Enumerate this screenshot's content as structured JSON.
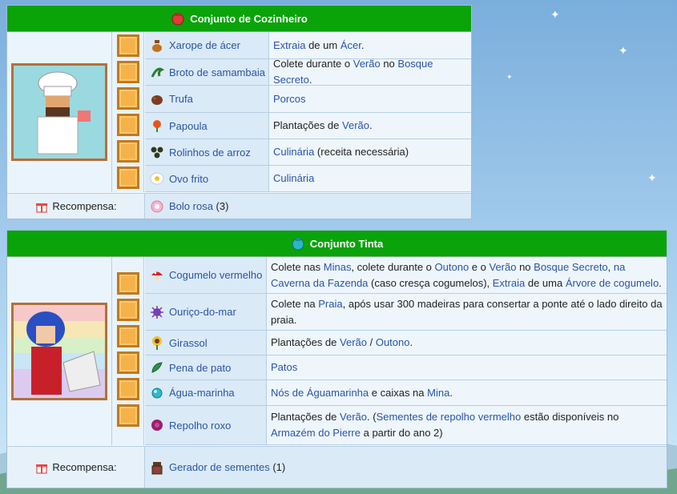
{
  "bundles": [
    {
      "title": "Conjunto de Cozinheiro",
      "items": [
        {
          "name": "Xarope de ácer",
          "desc": [
            {
              "t": "Extraia",
              "link": true
            },
            {
              "t": " de um "
            },
            {
              "t": "Ácer",
              "link": true
            },
            {
              "t": "."
            }
          ]
        },
        {
          "name": "Broto de samambaia",
          "desc": [
            {
              "t": "Colete durante o "
            },
            {
              "t": "Verão",
              "link": true
            },
            {
              "t": " no "
            },
            {
              "t": "Bosque Secreto",
              "link": true
            },
            {
              "t": "."
            }
          ]
        },
        {
          "name": "Trufa",
          "desc": [
            {
              "t": "Porcos",
              "link": true
            }
          ]
        },
        {
          "name": "Papoula",
          "desc": [
            {
              "t": "Plantações de "
            },
            {
              "t": "Verão",
              "link": true
            },
            {
              "t": "."
            }
          ]
        },
        {
          "name": "Rolinhos de arroz",
          "desc": [
            {
              "t": "Culinária",
              "link": true
            },
            {
              "t": " (receita necessária)"
            }
          ]
        },
        {
          "name": "Ovo frito",
          "desc": [
            {
              "t": "Culinária",
              "link": true
            }
          ]
        }
      ],
      "reward_label": "Recompensa:",
      "reward": "Bolo rosa",
      "reward_qty": " (3)"
    },
    {
      "title": "Conjunto Tinta",
      "items": [
        {
          "name": "Cogumelo vermelho",
          "desc": [
            {
              "t": "Colete nas "
            },
            {
              "t": "Minas",
              "link": true
            },
            {
              "t": ", colete durante o "
            },
            {
              "t": "Outono",
              "link": true
            },
            {
              "t": " e o "
            },
            {
              "t": "Verão",
              "link": true
            },
            {
              "t": " no "
            },
            {
              "t": "Bosque Secreto",
              "link": true
            },
            {
              "t": ", "
            },
            {
              "t": "na Caverna da Fazenda",
              "link": true
            },
            {
              "t": " (caso cresça cogumelos), "
            },
            {
              "t": "Extraia",
              "link": true
            },
            {
              "t": " de uma "
            },
            {
              "t": "Árvore de cogumelo",
              "link": true
            },
            {
              "t": "."
            }
          ]
        },
        {
          "name": "Ouriço-do-mar",
          "desc": [
            {
              "t": "Colete na "
            },
            {
              "t": "Praia",
              "link": true
            },
            {
              "t": ", após usar 300 madeiras para consertar a ponte até o lado direito da praia."
            }
          ]
        },
        {
          "name": "Girassol",
          "desc": [
            {
              "t": "Plantações de "
            },
            {
              "t": "Verão",
              "link": true
            },
            {
              "t": " / "
            },
            {
              "t": "Outono",
              "link": true
            },
            {
              "t": "."
            }
          ]
        },
        {
          "name": "Pena de pato",
          "desc": [
            {
              "t": "Patos",
              "link": true
            }
          ]
        },
        {
          "name": "Água-marinha",
          "desc": [
            {
              "t": "Nós de Águamarinha",
              "link": true
            },
            {
              "t": " e caixas na "
            },
            {
              "t": "Mina",
              "link": true
            },
            {
              "t": "."
            }
          ]
        },
        {
          "name": "Repolho roxo",
          "desc": [
            {
              "t": "Plantações de "
            },
            {
              "t": "Verão",
              "link": true
            },
            {
              "t": ". ("
            },
            {
              "t": "Sementes de repolho vermelho",
              "link": true
            },
            {
              "t": " estão disponíveis no "
            },
            {
              "t": "Armazém do Pierre",
              "link": true
            },
            {
              "t": " a partir do ano 2)"
            }
          ]
        }
      ],
      "reward_label": "Recompensa:",
      "reward": "Gerador de sementes",
      "reward_qty": " (1)"
    }
  ],
  "colors": {
    "header_green": "#0aa30a",
    "slot": "#f6b24a",
    "link": "#2a54a8"
  }
}
